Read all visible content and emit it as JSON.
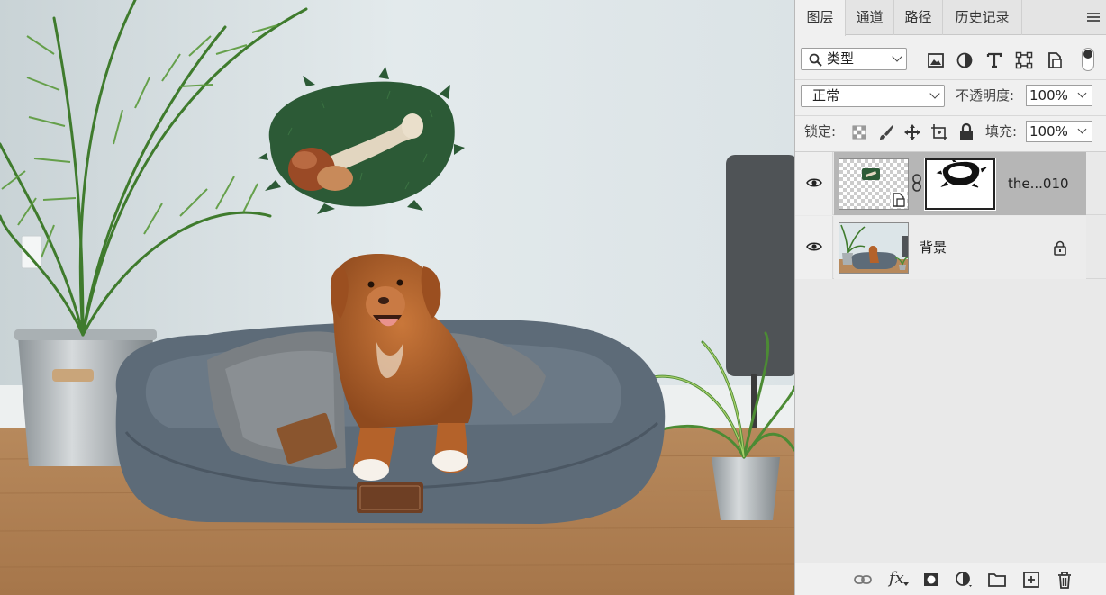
{
  "panel": {
    "tabs": [
      {
        "label": "图层",
        "active": true
      },
      {
        "label": "通道",
        "active": false
      },
      {
        "label": "路径",
        "active": false
      },
      {
        "label": "历史记录",
        "active": false
      }
    ],
    "menu_icon": "hamburger-icon"
  },
  "filter": {
    "kind_label": "类型",
    "icons": [
      "pixel-layer-filter-icon",
      "adjustment-layer-filter-icon",
      "type-layer-filter-icon",
      "shape-layer-filter-icon",
      "smart-object-filter-icon"
    ],
    "toggle": "filter-toggle"
  },
  "blend": {
    "mode": "正常",
    "opacity_label": "不透明度:",
    "opacity_value": "100%"
  },
  "lock": {
    "label": "锁定:",
    "icons": [
      "lock-transparent-pixels-icon",
      "lock-image-pixels-icon",
      "lock-position-icon",
      "prevent-auto-nesting-icon",
      "lock-all-icon"
    ],
    "fill_label": "填充:",
    "fill_value": "100%"
  },
  "layers": [
    {
      "name": "the...010",
      "visible": true,
      "selected": true,
      "smart_object": true,
      "has_mask": true,
      "linked": true
    },
    {
      "name": "背景",
      "visible": true,
      "selected": false,
      "locked": true
    }
  ],
  "bottom_icons": [
    "link-layers-icon",
    "fx-icon",
    "add-mask-icon",
    "adjustment-layer-icon",
    "new-group-icon",
    "new-layer-icon",
    "delete-layer-icon"
  ],
  "fx_label": "fx",
  "colors": {
    "panel_bg": "#f0f0f0",
    "selected_layer": "#b6b6b6",
    "wall": "#dde6e9",
    "floor": "#b98a5c",
    "bed": "#5d6b78",
    "dog": "#b4622a"
  }
}
